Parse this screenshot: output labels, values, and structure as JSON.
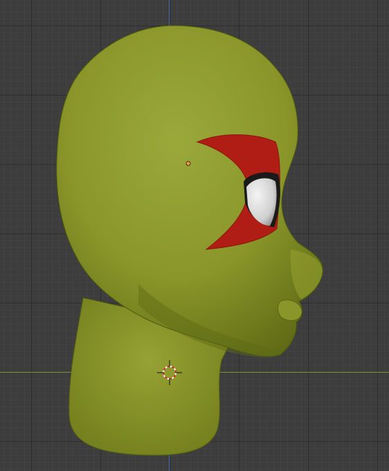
{
  "viewport": {
    "grid_color": "#3d3d3d",
    "x_axis_color": "#7c8f3a",
    "z_axis_color": "#4a6fb0"
  },
  "model": {
    "name_icon": "alien-head-mesh",
    "skin_color": "#8e9a2c",
    "eye_patch_color": "#b01d14",
    "eye_white_color": "#e6e6e6"
  },
  "gizmos": {
    "cursor_icon": "3d-cursor-icon",
    "origin_icon": "object-origin-icon",
    "origin_color": "#f0a030"
  }
}
